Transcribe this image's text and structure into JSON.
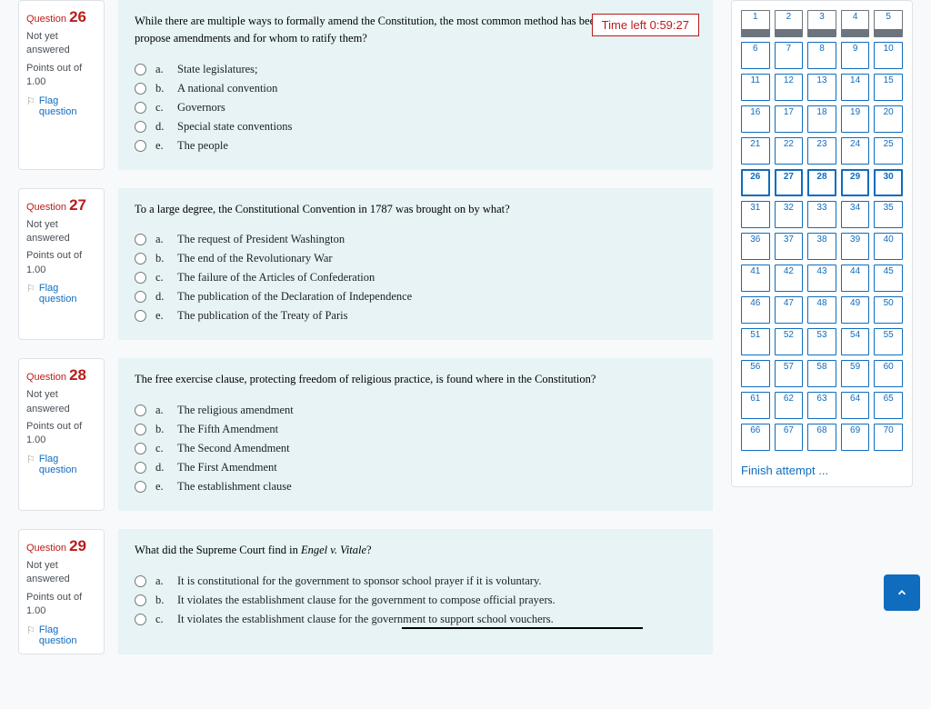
{
  "timer": {
    "label": "Time left 0:59:27"
  },
  "info_labels": {
    "question_word": "Question",
    "status": "Not yet answered",
    "points": "Points out of 1.00",
    "flag": "Flag question"
  },
  "finish_label": "Finish attempt ...",
  "nav": {
    "total": 70,
    "done_through": 5,
    "current_from": 26,
    "current_to": 30
  },
  "questions": [
    {
      "number": "26",
      "text": "While there are multiple ways to formally amend the Constitution, the most common method has been for Congress to propose amendments and for whom to ratify them?",
      "options": [
        {
          "l": "a.",
          "t": "State legislatures;"
        },
        {
          "l": "b.",
          "t": "A national convention"
        },
        {
          "l": "c.",
          "t": "Governors"
        },
        {
          "l": "d.",
          "t": "Special state conventions"
        },
        {
          "l": "e.",
          "t": "The people"
        }
      ]
    },
    {
      "number": "27",
      "text": "To a large degree, the Constitutional Convention in 1787 was brought on by what?",
      "options": [
        {
          "l": "a.",
          "t": "The request of President Washington"
        },
        {
          "l": "b.",
          "t": "The end of the Revolutionary War"
        },
        {
          "l": "c.",
          "t": "The failure of the Articles of Confederation"
        },
        {
          "l": "d.",
          "t": "The publication of the Declaration of Independence"
        },
        {
          "l": "e.",
          "t": "The publication of the Treaty of Paris"
        }
      ]
    },
    {
      "number": "28",
      "text": "The free exercise clause, protecting freedom of religious practice, is found where in the Constitution?",
      "options": [
        {
          "l": "a.",
          "t": "The religious amendment"
        },
        {
          "l": "b.",
          "t": "The Fifth Amendment"
        },
        {
          "l": "c.",
          "t": "The Second Amendment"
        },
        {
          "l": "d.",
          "t": "The First Amendment"
        },
        {
          "l": "e.",
          "t": "The establishment clause"
        }
      ]
    },
    {
      "number": "29",
      "text_html": "What did the Supreme Court find in <span class=\"ital\">Engel v. Vitale</span>?",
      "options": [
        {
          "l": "a.",
          "t": "It is constitutional for the government to sponsor school prayer if it is voluntary."
        },
        {
          "l": "b.",
          "t": "It violates the establishment clause for the government to compose official prayers."
        },
        {
          "l": "c.",
          "t": "It violates the establishment clause for the government to support school vouchers."
        }
      ]
    }
  ]
}
